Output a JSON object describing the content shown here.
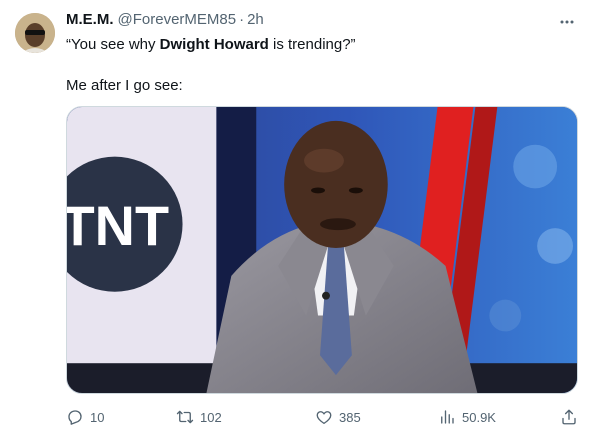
{
  "author": {
    "name": "M.E.M.",
    "handle": "@ForeverMEM85",
    "separator": "·",
    "time": "2h"
  },
  "tweet": {
    "text_open": "“You see why ",
    "text_bold": "Dwight Howard",
    "text_close": " is trending?”",
    "text_line2": "Me after I go see:"
  },
  "media": {
    "logo_text": "TNT"
  },
  "actions": {
    "replies": "10",
    "retweets": "102",
    "likes": "385",
    "views": "50.9K"
  },
  "icons": {
    "more": "more-icon",
    "reply": "reply-icon",
    "retweet": "retweet-icon",
    "like": "like-icon",
    "views": "views-icon",
    "share": "share-icon"
  },
  "colors": {
    "text_primary": "#0f1419",
    "text_secondary": "#536471",
    "border": "#cfd9de"
  }
}
